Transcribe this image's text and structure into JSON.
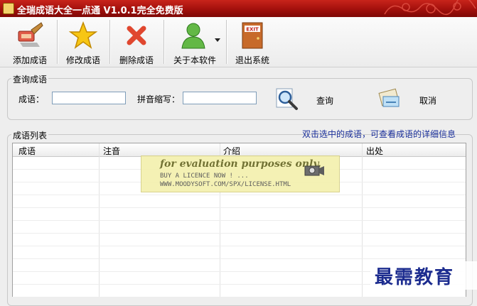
{
  "window": {
    "title": "全瑞成语大全一点通 V1.0.1完全免费版"
  },
  "toolbar": {
    "buttons": [
      {
        "label": "添加成语",
        "icon": "brush-icon"
      },
      {
        "label": "修改成语",
        "icon": "star-icon"
      },
      {
        "label": "删除成语",
        "icon": "delete-x-icon"
      },
      {
        "label": "关于本软件",
        "icon": "user-icon"
      },
      {
        "label": "退出系统",
        "icon": "exit-door-icon"
      }
    ]
  },
  "query": {
    "title": "查询成语",
    "idiom_label": "成语：",
    "idiom_value": "",
    "pinyin_label": "拼音缩写：",
    "pinyin_value": "",
    "search_label": "查询",
    "cancel_label": "取消"
  },
  "list": {
    "title": "成语列表",
    "hint": "双击选中的成语，可查看成语的详细信息",
    "columns": [
      "成语",
      "注音",
      "介绍",
      "出处"
    ],
    "rows": []
  },
  "watermark": {
    "line1": "for evaluation purposes only.",
    "line2": "BUY A LICENCE NOW ! ...",
    "line3": "WWW.MOODYSOFT.COM/SPX/LICENSE.HTML",
    "corner": "最需教育"
  },
  "colors": {
    "titlebar": "#a2100c",
    "hint_text": "#1a2f9a"
  }
}
